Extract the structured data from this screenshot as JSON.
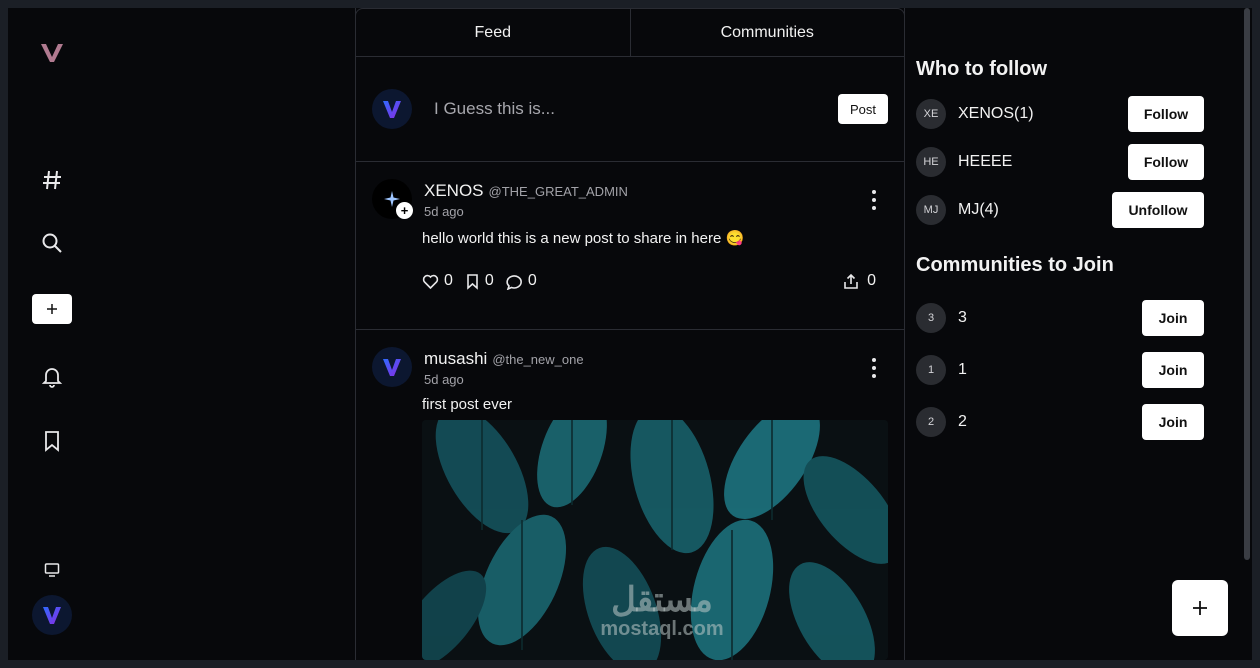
{
  "sidebar": {
    "logo_icon": "v-logo-icon",
    "nav": [
      {
        "icon": "hashtag-icon"
      },
      {
        "icon": "search-icon"
      },
      {
        "icon": "plus-icon"
      },
      {
        "icon": "bell-icon"
      },
      {
        "icon": "bookmark-icon"
      }
    ],
    "bottom": [
      {
        "icon": "monitor-icon"
      },
      {
        "icon": "avatar"
      }
    ]
  },
  "tabs": [
    {
      "label": "Feed"
    },
    {
      "label": "Communities"
    }
  ],
  "composer": {
    "placeholder": "I Guess this is...",
    "post_label": "Post"
  },
  "posts": [
    {
      "name": "XENOS",
      "handle": "@THE_GREAT_ADMIN",
      "time": "5d ago",
      "text": "hello world this is a new post to share in here 😋",
      "likes": "0",
      "bookmarks": "0",
      "comments": "0",
      "shares": "0"
    },
    {
      "name": "musashi",
      "handle": "@the_new_one",
      "time": "5d ago",
      "text": "first post ever",
      "image_watermark_ar": "مستقل",
      "image_watermark_en": "mostaql.com"
    }
  ],
  "who_to_follow": {
    "title": "Who to follow",
    "users": [
      {
        "initials": "XE",
        "name": "XENOS(1)",
        "action": "Follow"
      },
      {
        "initials": "HE",
        "name": "HEEEE",
        "action": "Follow"
      },
      {
        "initials": "MJ",
        "name": "MJ(4)",
        "action": "Unfollow"
      }
    ]
  },
  "communities": {
    "title": "Communities to Join",
    "items": [
      {
        "initial": "3",
        "name": "3",
        "action": "Join"
      },
      {
        "initial": "1",
        "name": "1",
        "action": "Join"
      },
      {
        "initial": "2",
        "name": "2",
        "action": "Join"
      }
    ]
  },
  "colors": {
    "background": "#07080b",
    "border": "#2a2c33",
    "logo": "#b07a90",
    "brand_gradient_start": "#2f6bff",
    "brand_gradient_end": "#8a2be2"
  }
}
